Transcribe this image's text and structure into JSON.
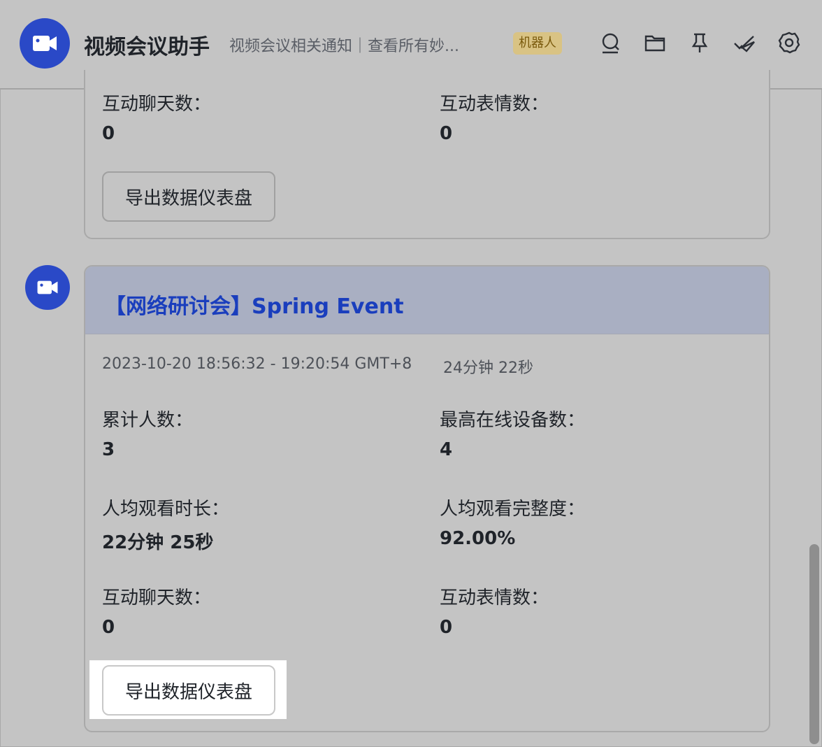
{
  "header": {
    "title": "视频会议助手",
    "subtitle": "视频会议相关通知｜查看所有妙...",
    "badge": "机器人",
    "icons": [
      "search-icon",
      "folder-icon",
      "pin-icon",
      "done-check-icon",
      "settings-gear-icon"
    ]
  },
  "prev_card": {
    "stats": [
      {
        "label": "互动聊天数：",
        "value": "0"
      },
      {
        "label": "互动表情数：",
        "value": "0"
      }
    ],
    "button": "导出数据仪表盘"
  },
  "card": {
    "title": "【网络研讨会】Spring Event",
    "time_range": "2023-10-20 18:56:32 - 19:20:54 GMT+8",
    "duration": "24分钟 22秒",
    "stats": [
      {
        "label": "累计人数：",
        "value": "3"
      },
      {
        "label": "最高在线设备数：",
        "value": "4"
      },
      {
        "label": "人均观看时长：",
        "value": "22分钟 25秒"
      },
      {
        "label": "人均观看完整度：",
        "value": "92.00%"
      },
      {
        "label": "互动聊天数：",
        "value": "0"
      },
      {
        "label": "互动表情数：",
        "value": "0"
      }
    ],
    "button": "导出数据仪表盘"
  },
  "colors": {
    "brand": "#2a49c7",
    "title_blue": "#1a3ebd",
    "badge_bg": "#d9c384"
  }
}
